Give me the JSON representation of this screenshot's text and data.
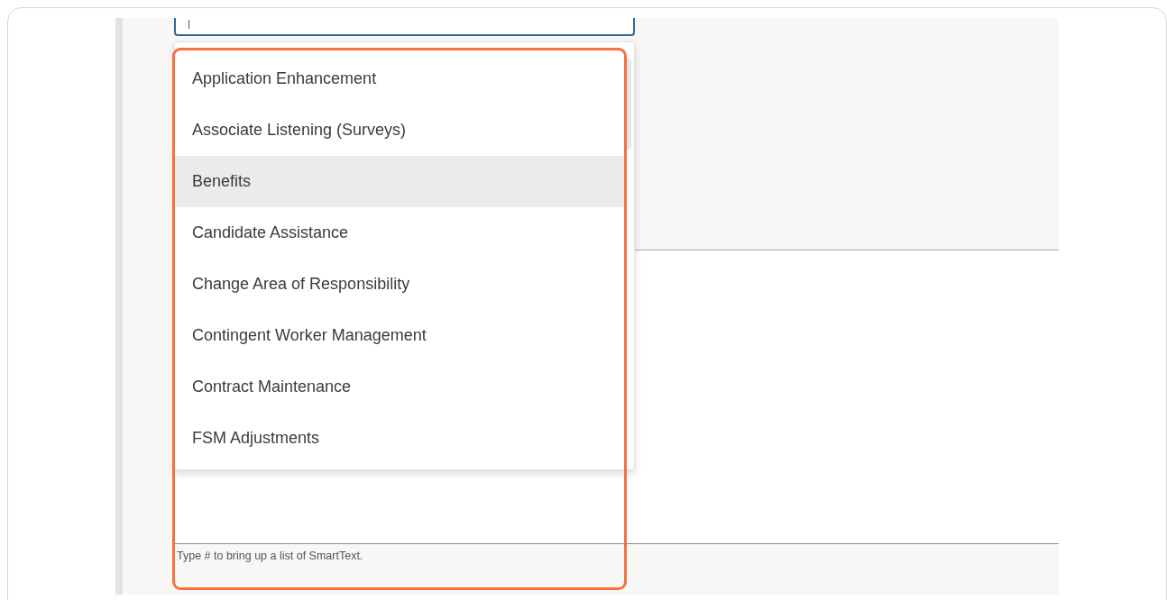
{
  "dropdown": {
    "items": [
      {
        "label": "Application Enhancement",
        "selected": false
      },
      {
        "label": "Associate Listening (Surveys)",
        "selected": false
      },
      {
        "label": "Benefits",
        "selected": true
      },
      {
        "label": "Candidate Assistance",
        "selected": false
      },
      {
        "label": "Change Area of Responsibility",
        "selected": false
      },
      {
        "label": "Contingent Worker Management",
        "selected": false
      },
      {
        "label": "Contract Maintenance",
        "selected": false
      },
      {
        "label": "FSM Adjustments",
        "selected": false
      }
    ]
  },
  "text_area": {
    "hint": "Type # to bring up a list of SmartText."
  }
}
